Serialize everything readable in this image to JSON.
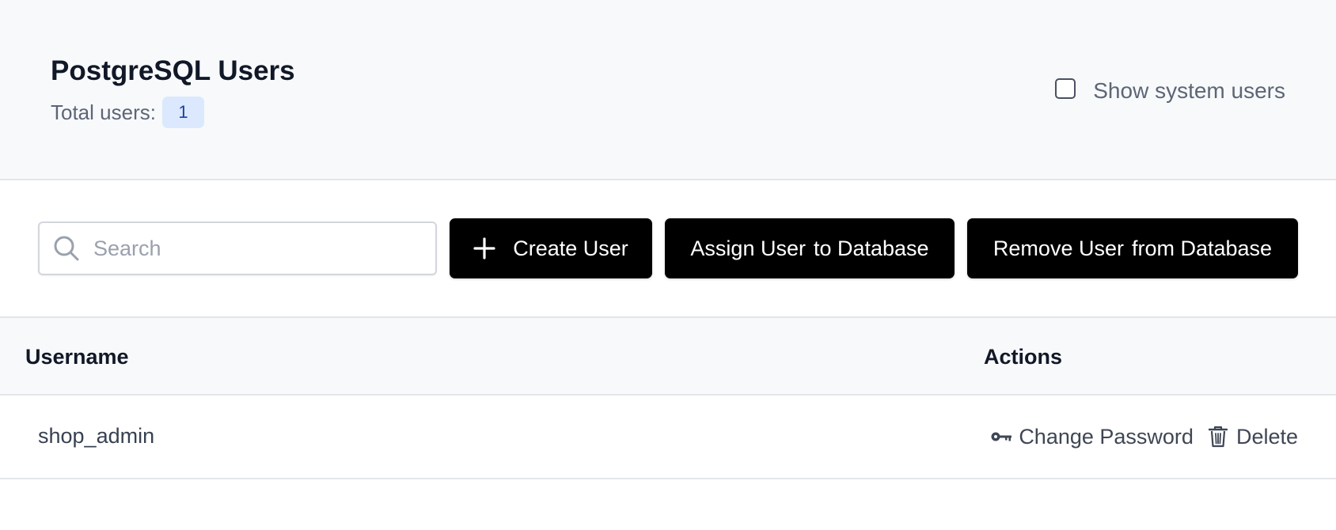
{
  "header": {
    "title": "PostgreSQL Users",
    "total_label": "Total users:",
    "total_count": "1",
    "system_users_toggle": {
      "label": "Show system users",
      "checked": false
    }
  },
  "toolbar": {
    "search": {
      "placeholder": "Search",
      "value": "",
      "icon": "search-icon"
    },
    "buttons": {
      "create": {
        "label": "Create User",
        "icon": "plus-icon"
      },
      "assign": {
        "label_part1": "Assign User",
        "label_part2": "to Database"
      },
      "remove": {
        "label_part1": "Remove User",
        "label_part2": "from Database"
      }
    }
  },
  "table": {
    "columns": [
      "Username",
      "Actions"
    ],
    "rows": [
      {
        "username": "shop_admin",
        "actions": {
          "change_password": {
            "label": "Change Password",
            "icon": "key-icon"
          },
          "delete": {
            "label": "Delete",
            "icon": "trash-icon"
          }
        }
      }
    ]
  },
  "colors": {
    "header_bg": "#f8f9fb",
    "primary_button_bg": "#000000",
    "badge_bg": "#dbe8fd",
    "badge_text": "#1d3f9c",
    "muted_text": "#5c6676",
    "border": "#e3e5e9"
  }
}
